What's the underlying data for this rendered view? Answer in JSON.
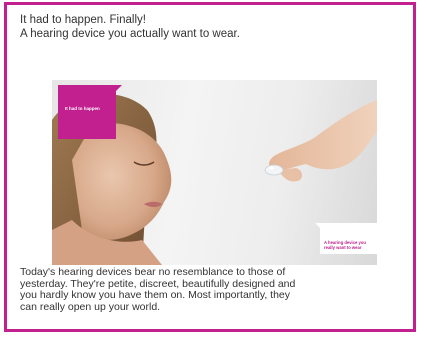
{
  "headline": {
    "line1": "It had to happen. Finally!",
    "line2": "A hearing device you actually want to wear."
  },
  "image": {
    "tag_top": "It had to happen",
    "tag_bottom_line1": "A hearing device you",
    "tag_bottom_line2": "really want to wear"
  },
  "body": {
    "line1": "Today's hearing devices bear no resemblance to those of",
    "line2": "yesterday. They're petite, discreet, beautifully designed and",
    "line3": "you hardly know you have them on. Most importantly, they",
    "line4": "can really open up your world."
  },
  "colors": {
    "brand": "#c1208e",
    "text": "#333333",
    "background": "#ffffff"
  }
}
